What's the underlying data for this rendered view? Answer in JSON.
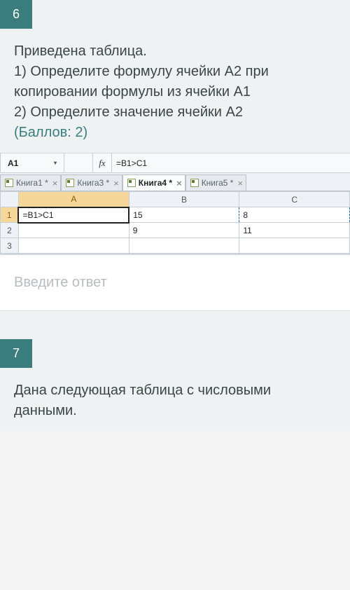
{
  "q6": {
    "number": "6",
    "line0": "Приведена таблица.",
    "line1": "1) Определите формулу ячейки А2 при копировании формулы из ячейки А1",
    "line2": "2) Определите значение ячейки А2",
    "points": "(Баллов: 2)"
  },
  "excel": {
    "namebox": "A1",
    "fx_symbol": "fx",
    "formula": "=B1>C1",
    "tabs": {
      "t1": "Книга1 *",
      "t2": "Книга3 *",
      "t3": "Книга4 *",
      "t4": "Книга5 *"
    },
    "headers": {
      "a": "A",
      "b": "B",
      "c": "C"
    },
    "rows": {
      "r1": "1",
      "r2": "2",
      "r3": "3",
      "a1": "=B1>C1",
      "b1": "15",
      "c1": "8",
      "a2": "",
      "b2": "9",
      "c2": "11"
    }
  },
  "answer_placeholder": "Введите ответ",
  "q7": {
    "number": "7",
    "line0": "Дана следующая таблица с числовыми данными."
  },
  "glyphs": {
    "close": "×",
    "check": "✓",
    "chevron": "▾"
  }
}
